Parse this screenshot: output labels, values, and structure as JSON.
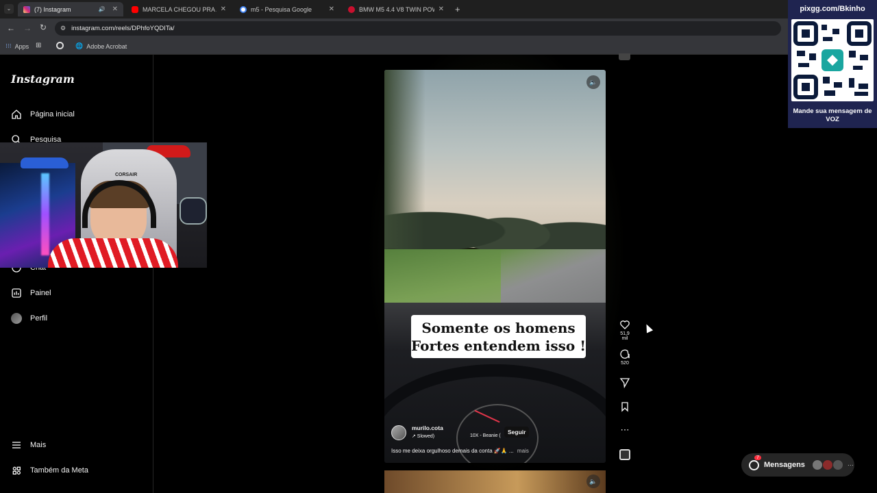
{
  "browser": {
    "tabs": [
      {
        "title": "(7) Instagram",
        "color": "#dd2a7b"
      },
      {
        "title": "MARCELA CHEGOU PRA AGILIZ",
        "color": "#ff0000"
      },
      {
        "title": "m5 - Pesquisa Google",
        "color": "#4285f4"
      },
      {
        "title": "BMW M5 4.4 V8 TWIN POWER",
        "color": "#c8102e"
      }
    ],
    "url": "instagram.com/reels/DPhfoYQDITa/",
    "bookmarks": [
      "Apps",
      "Adobe Acrobat"
    ]
  },
  "sidebar": {
    "logo": "Instagram",
    "items": [
      "Página inicial",
      "Pesquisa",
      "Chat",
      "Painel",
      "Perfil"
    ],
    "bottom": [
      "Mais",
      "Também da Meta"
    ]
  },
  "reel": {
    "caption_overlay_line1": "Somente os homens",
    "caption_overlay_line2": "Fortes entendem isso !",
    "username": "murilo.cota",
    "audio": "↗ Slowed)",
    "audio_track": "10X - Beanie (",
    "follow": "Seguir",
    "caption": "Isso me deixa orgulhoso demais da conta 🚀🙏 ...",
    "more": "mais"
  },
  "actions": {
    "likes": "51,9 mil",
    "comments": "520"
  },
  "overlay": {
    "site": "pixgg.com/Bkinho",
    "message": "Mande sua mensagem de VOZ",
    "webcam_brand": "CORSAIR"
  },
  "messages": {
    "label": "Mensagens",
    "badge": "7"
  }
}
